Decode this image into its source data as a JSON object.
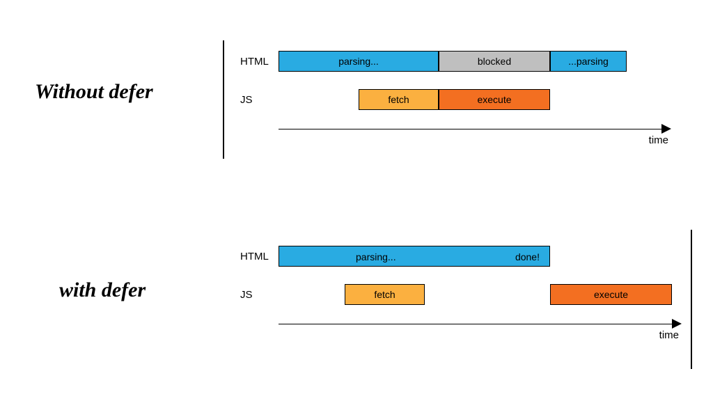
{
  "titles": {
    "without": "Without defer",
    "with": "with defer"
  },
  "row_labels": {
    "html": "HTML",
    "js": "JS"
  },
  "segments": {
    "parsing": "parsing...",
    "blocked": "blocked",
    "parsing2": "...parsing",
    "fetch": "fetch",
    "execute": "execute",
    "done": "done!"
  },
  "axis": "time"
}
